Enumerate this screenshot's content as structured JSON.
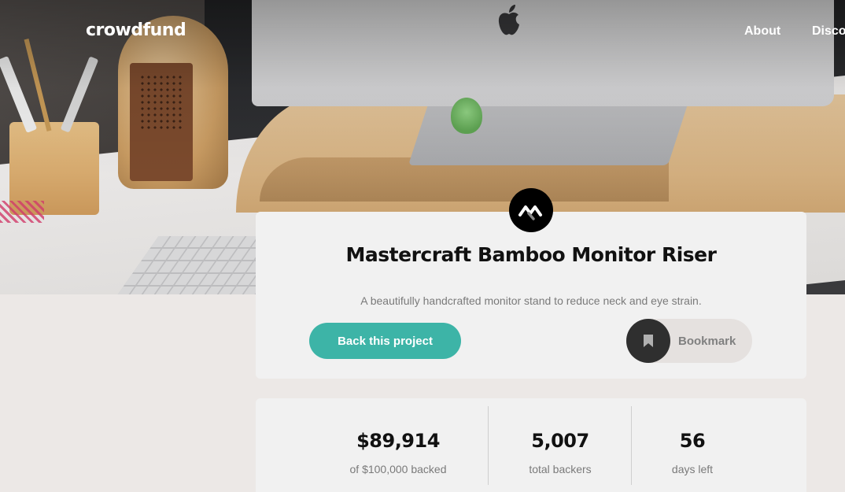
{
  "header": {
    "logo": "crowdfund",
    "nav": [
      {
        "label": "About"
      },
      {
        "label": "Discover"
      }
    ]
  },
  "project": {
    "title": "Mastercraft Bamboo Monitor Riser",
    "description": "A beautifully handcrafted monitor stand to reduce neck and eye strain.",
    "back_button_label": "Back this project",
    "bookmark_label": "Bookmark"
  },
  "stats": {
    "backed": {
      "value": "$89,914",
      "label": "of $100,000 backed"
    },
    "backers": {
      "value": "5,007",
      "label": "total backers"
    },
    "days": {
      "value": "56",
      "label": "days left"
    }
  },
  "colors": {
    "accent": "#3db4a7",
    "page_bg": "#ece8e6",
    "card_bg": "#f1f1f1",
    "badge": "#000000"
  },
  "icons": {
    "brand": "mastercraft-logo-icon",
    "bookmark": "bookmark-icon"
  }
}
